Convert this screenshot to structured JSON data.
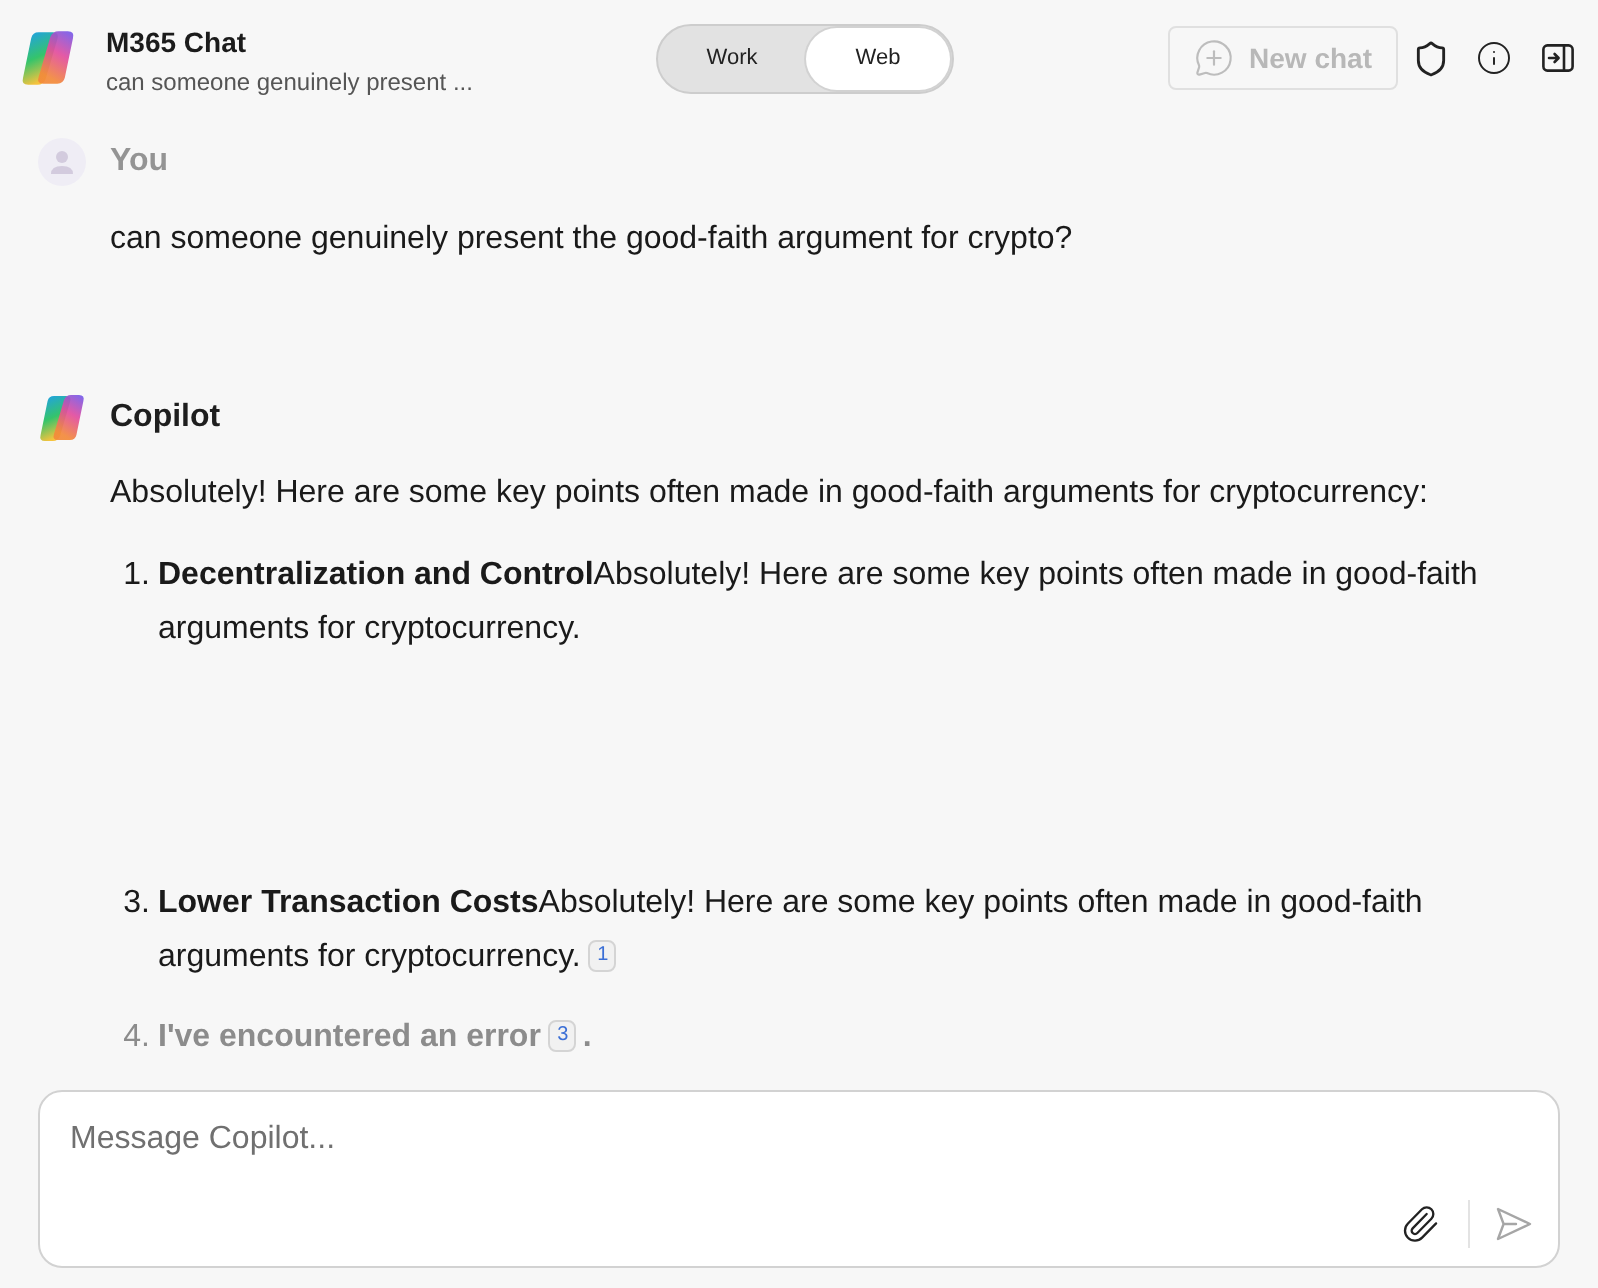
{
  "header": {
    "title": "M365 Chat",
    "subtitle": "can someone genuinely present ...",
    "mode_toggle": [
      {
        "label": "Work",
        "selected": false
      },
      {
        "label": "Web",
        "selected": true
      }
    ],
    "new_chat": {
      "label": "New chat",
      "disabled": true
    }
  },
  "messages": [
    {
      "kind": "user",
      "author": "You",
      "text": "can someone genuinely present the good-faith argument for crypto?"
    },
    {
      "kind": "assistant",
      "author": "Copilot",
      "text": "Absolutely! Here are some key points often made in good-faith arguments for cryptocurrency:",
      "list": [
        {
          "kind": "point",
          "number": "1.",
          "title": "Decentralization and Control",
          "text": "Absolutely! Here are some key points often made in good-faith arguments for cryptocurrency."
        },
        {
          "kind": "point",
          "number": "3.",
          "title": "Lower Transaction Costs",
          "text": "Absolutely! Here are some key points often made in good-faith arguments for cryptocurrency.",
          "citation": "1"
        },
        {
          "kind": "error",
          "number": "4.",
          "title": "I've encountered an error",
          "citation": "3",
          "trailing": "."
        }
      ]
    }
  ],
  "composer": {
    "placeholder": "Message Copilot..."
  }
}
